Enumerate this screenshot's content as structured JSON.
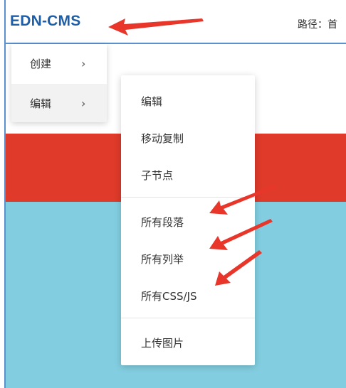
{
  "header": {
    "logo": "EDN-CMS",
    "path_label": "路径：首"
  },
  "main_menu": [
    {
      "label": "创建",
      "chevron": "›"
    },
    {
      "label": "编辑",
      "chevron": "›"
    }
  ],
  "submenu": {
    "groups": [
      [
        "编辑",
        "移动复制",
        "子节点"
      ],
      [
        "所有段落",
        "所有列举",
        "所有CSS/JS"
      ],
      [
        "上传图片"
      ]
    ]
  },
  "colors": {
    "logo": "#1d5ea8",
    "red_band": "#df3a2a",
    "blue_area": "#82cee0",
    "annotation_arrow": "#e8362b"
  },
  "annotations": [
    "arrow-icon",
    "arrow-icon",
    "arrow-icon",
    "arrow-icon"
  ]
}
